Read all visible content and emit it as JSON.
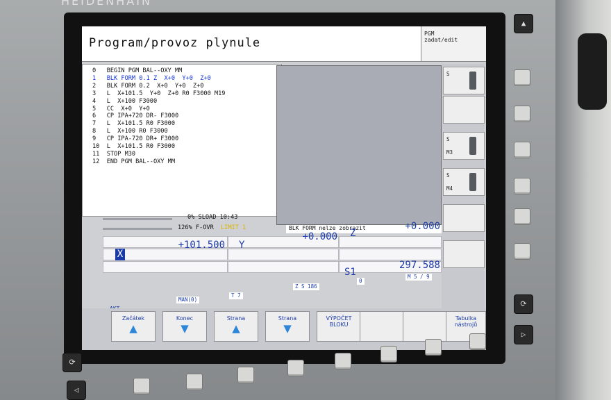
{
  "brand": "HEIDENHAIN",
  "header": {
    "title": "Program/provoz plynule",
    "mode_line1": "PGM",
    "mode_line2": "zadat/edit"
  },
  "program": {
    "lines": [
      "0   BEGIN PGM BAL--OXY MM",
      "1   BLK FORM 0.1 Z  X+0  Y+0  Z+0",
      "2   BLK FORM 0.2  X+0  Y+0  Z+0",
      "3   L  X+101.5  Y+0  Z+0 R0 F3000 M19",
      "4   L  X+100 F3000",
      "5   CC  X+0  Y+0",
      "6   CP IPA+720 DR- F3000",
      "7   L  X+101.5 R0 F3000",
      "8   L  X+100 R0 F3000",
      "9   CP IPA-720 DR+ F3000",
      "10  L  X+101.5 R0 F3000",
      "11  STOP M30",
      "12  END PGM BAL--OXY MM"
    ],
    "selected_index": 1
  },
  "graphics_message": "BLK FORM nelze zobrazit",
  "load": {
    "sload": "0% SLOAD 10:43",
    "fovr": "126% F-OVR",
    "limit": "LIMIT 1"
  },
  "positions": {
    "x_label": "X",
    "x_value": "+101.500",
    "y_label": "Y",
    "y_value": "+0.000",
    "z_label": "Z",
    "z_value": "+0.000",
    "s_label": "S1",
    "s_value": "297.588",
    "ms": "M 5 / 9",
    "zs": "Z S 186",
    "f": "0",
    "t": "T 7",
    "man": "MAN(0)",
    "akt": "AKT."
  },
  "side_keys": [
    {
      "label": "S",
      "sub": ""
    },
    {
      "label": "",
      "sub": ""
    },
    {
      "label": "S",
      "sub": "M3"
    },
    {
      "label": "S",
      "sub": "M4"
    },
    {
      "label": "",
      "sub": ""
    },
    {
      "label": "",
      "sub": ""
    }
  ],
  "bottom_keys": [
    {
      "label": "Začátek",
      "arrow": "up"
    },
    {
      "label": "Konec",
      "arrow": "down"
    },
    {
      "label": "Strana",
      "arrow": "up"
    },
    {
      "label": "Strana",
      "arrow": "down"
    },
    {
      "label": "VÝPOČET BLOKU",
      "arrow": ""
    },
    {
      "label": "",
      "arrow": ""
    },
    {
      "label": "",
      "arrow": ""
    },
    {
      "label": "Tabulka nástrojů",
      "arrow": ""
    }
  ],
  "icons": {
    "up": "▲",
    "down": "▼",
    "right": "▷",
    "left": "◁",
    "cycle": "⟳"
  }
}
